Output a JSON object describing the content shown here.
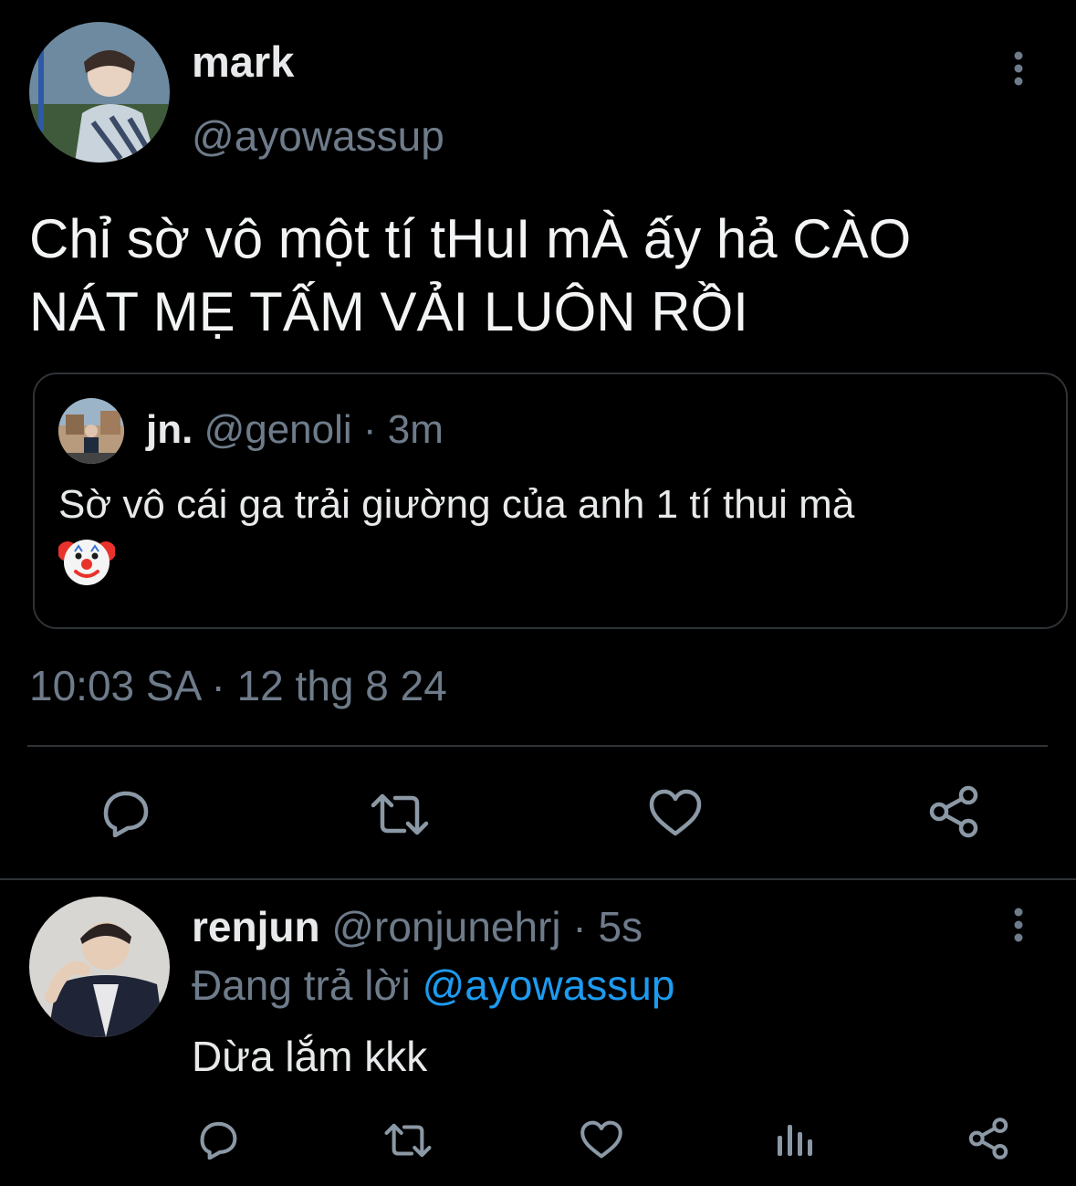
{
  "main_tweet": {
    "display_name": "mark",
    "handle": "@ayowassup",
    "text_line1": "Chỉ sờ vô một tí tHuI mÀ ấy hả CÀO",
    "text_line2": "NÁT MẸ TẤM VẢI LUÔN RỒI",
    "timestamp": "10:03 SA · 12 thg 8 24",
    "more_icon": "vertical-ellipsis-icon"
  },
  "quoted_tweet": {
    "display_name": "jn.",
    "handle": "@genoli",
    "separator": " · ",
    "time": "3m",
    "text": "Sờ vô cái ga trải giường của anh 1 tí thui mà",
    "emoji": "🤡"
  },
  "actions": {
    "icons": [
      "reply-icon",
      "retweet-icon",
      "like-icon",
      "share-icon"
    ]
  },
  "reply": {
    "display_name": "renjun",
    "handle": "@ronjunehrj",
    "separator": " · ",
    "time": "5s",
    "replying_prefix": "Đang trả lời ",
    "replying_to": "@ayowassup",
    "text": "Dừa lắm kkk",
    "icons": [
      "reply-icon",
      "retweet-icon",
      "like-icon",
      "analytics-icon",
      "share-icon"
    ]
  },
  "colors": {
    "background": "#000000",
    "text": "#e7e9ea",
    "secondary": "#6e7b8a",
    "link": "#1d9bf0",
    "border": "#2f3336"
  }
}
